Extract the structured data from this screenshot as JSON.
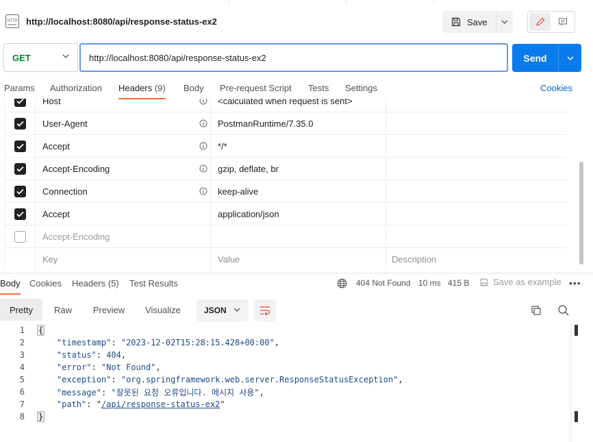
{
  "request": {
    "icon": "http-file-icon",
    "title": "http://localhost:8080/api/response-status-ex2",
    "save_label": "Save",
    "method": "GET",
    "url": "http://localhost:8080/api/response-status-ex2",
    "send_label": "Send"
  },
  "request_tabs": [
    {
      "label": "Params"
    },
    {
      "label": "Authorization"
    },
    {
      "label": "Headers",
      "count": "(9)",
      "active": true
    },
    {
      "label": "Body"
    },
    {
      "label": "Pre-request Script"
    },
    {
      "label": "Tests"
    },
    {
      "label": "Settings"
    }
  ],
  "cookies_link": "Cookies",
  "headers": {
    "rows": [
      {
        "checked": true,
        "key": "Host",
        "info": true,
        "value": "<calculated when request is sent>",
        "description": ""
      },
      {
        "checked": true,
        "key": "User-Agent",
        "info": true,
        "value": "PostmanRuntime/7.35.0",
        "description": ""
      },
      {
        "checked": true,
        "key": "Accept",
        "info": true,
        "value": "*/*",
        "description": ""
      },
      {
        "checked": true,
        "key": "Accept-Encoding",
        "info": true,
        "value": "gzip, deflate, br",
        "description": ""
      },
      {
        "checked": true,
        "key": "Connection",
        "info": true,
        "value": "keep-alive",
        "description": ""
      },
      {
        "checked": true,
        "key": "Accept",
        "info": false,
        "value": "application/json",
        "description": ""
      },
      {
        "checked": false,
        "key": "Accept-Encoding",
        "info": false,
        "value": "",
        "description": ""
      }
    ],
    "placeholder": {
      "key": "Key",
      "value": "Value",
      "description": "Description"
    }
  },
  "response_tabs": [
    {
      "label": "Body",
      "active": true
    },
    {
      "label": "Cookies"
    },
    {
      "label": "Headers (5)"
    },
    {
      "label": "Test Results"
    }
  ],
  "response_meta": {
    "status": "404 Not Found",
    "time": "10 ms",
    "size": "415 B",
    "save_example": "Save as example"
  },
  "view_tabs": [
    "Pretty",
    "Raw",
    "Preview",
    "Visualize"
  ],
  "format": "JSON",
  "code_lines": [
    {
      "n": "1"
    },
    {
      "n": "2"
    },
    {
      "n": "3"
    },
    {
      "n": "4"
    },
    {
      "n": "5"
    },
    {
      "n": "6"
    },
    {
      "n": "7"
    },
    {
      "n": "8"
    }
  ],
  "body": {
    "timestamp_key": "\"timestamp\"",
    "timestamp_val": "\"2023-12-02T15:28:15.428+00:00\"",
    "status_key": "\"status\"",
    "status_val": "404",
    "error_key": "\"error\"",
    "error_val": "\"Not Found\"",
    "exception_key": "\"exception\"",
    "exception_val": "\"org.springframework.web.server.ResponseStatusException\"",
    "message_key": "\"message\"",
    "message_val": "\"잘못된 요청 오류입니다. 메시지 사용\"",
    "path_key": "\"path\"",
    "path_val": "/api/response-status-ex2"
  }
}
